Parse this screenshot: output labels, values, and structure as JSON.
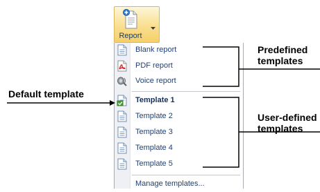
{
  "ribbon": {
    "report_label": "Report"
  },
  "menu": {
    "predefined": [
      {
        "label": "Blank report",
        "icon": "blank-report-icon"
      },
      {
        "label": "PDF report",
        "icon": "pdf-icon"
      },
      {
        "label": "Voice report",
        "icon": "voice-report-icon"
      }
    ],
    "user_defined": [
      {
        "label": "Template 1",
        "icon": "default-template-icon",
        "default": true
      },
      {
        "label": "Template 2",
        "icon": "template-icon"
      },
      {
        "label": "Template 3",
        "icon": "template-icon"
      },
      {
        "label": "Template 4",
        "icon": "template-icon"
      },
      {
        "label": "Template 5",
        "icon": "template-icon"
      }
    ],
    "manage_label": "Manage templates..."
  },
  "annotations": {
    "predefined_line1": "Predefined",
    "predefined_line2": "templates",
    "default_template": "Default template",
    "user_defined_line1": "User-defined",
    "user_defined_line2": "templates"
  }
}
